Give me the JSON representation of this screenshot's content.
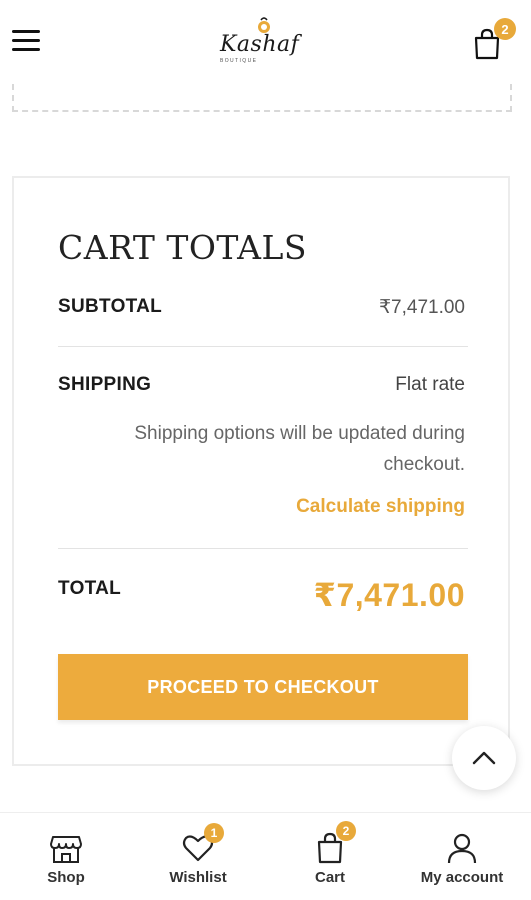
{
  "header": {
    "logo_text": "Kashaf",
    "logo_sub": "BOUTIQUE",
    "cart_count": "2"
  },
  "cart_totals": {
    "title": "CART TOTALS",
    "subtotal_label": "SUBTOTAL",
    "subtotal_value": "₹7,471.00",
    "shipping_label": "SHIPPING",
    "shipping_method": "Flat rate",
    "shipping_note": "Shipping options will be updated during checkout.",
    "calculate_shipping": "Calculate shipping",
    "total_label": "TOTAL",
    "total_value": "₹7,471.00",
    "checkout_button": "PROCEED TO CHECKOUT"
  },
  "bottom_nav": {
    "items": [
      {
        "label": "Shop",
        "icon": "store-icon"
      },
      {
        "label": "Wishlist",
        "icon": "heart-icon",
        "badge": "1"
      },
      {
        "label": "Cart",
        "icon": "shopping-bag-icon",
        "badge": "2"
      },
      {
        "label": "My account",
        "icon": "user-icon"
      }
    ]
  },
  "colors": {
    "accent": "#e8a93a",
    "text": "#1b1b1b",
    "muted": "#666666"
  }
}
